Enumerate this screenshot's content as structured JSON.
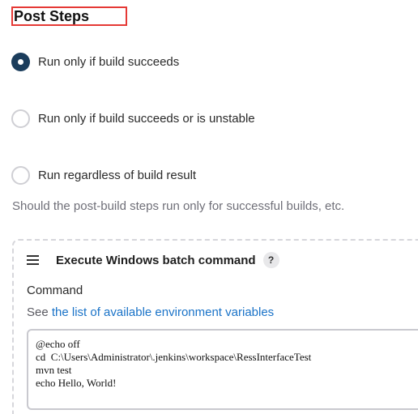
{
  "section": {
    "title": "Post Steps"
  },
  "options": [
    {
      "label": "Run only if build succeeds",
      "checked": true
    },
    {
      "label": "Run only if build succeeds or is unstable",
      "checked": false
    },
    {
      "label": "Run regardless of build result",
      "checked": false
    }
  ],
  "help_text": "Should the post-build steps run only for successful builds, etc.",
  "step": {
    "title": "Execute Windows batch command",
    "help_icon": "?",
    "command_label": "Command",
    "see_prefix": "See ",
    "see_link": "the list of available environment variables",
    "command_value": "@echo off\ncd  C:\\Users\\Administrator\\.jenkins\\workspace\\RessInterfaceTest\nmvn test\necho Hello, World!"
  },
  "colors": {
    "radio_selected": "#1b3d5c",
    "link": "#1a73c8",
    "title_highlight": "#e53935"
  }
}
